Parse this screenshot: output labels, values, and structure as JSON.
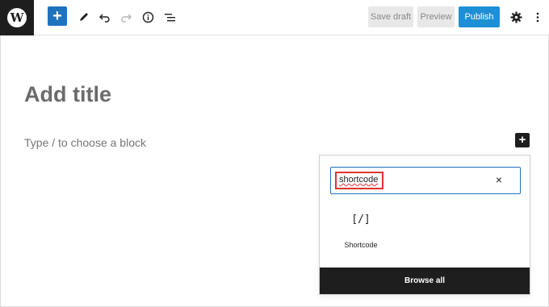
{
  "toolbar": {
    "logo_letter": "W",
    "add_icon": "+",
    "edit_icon": "pencil-icon",
    "undo_icon": "undo-icon",
    "redo_icon": "redo-icon",
    "info_icon": "info-icon",
    "list_view_icon": "list-view-icon",
    "save_draft_label": "Save draft",
    "preview_label": "Preview",
    "publish_label": "Publish",
    "settings_icon": "gear-icon",
    "more_icon": "vertical-ellipsis-icon"
  },
  "editor": {
    "title_placeholder": "Add title",
    "block_placeholder": "Type / to choose a block",
    "inserter_toggle": "+"
  },
  "inserter": {
    "search_value": "shortcode",
    "clear_icon": "×",
    "results": [
      {
        "icon": "[/]",
        "label": "Shortcode"
      }
    ],
    "browse_all_label": "Browse all"
  },
  "colors": {
    "primary_blue": "#1e73be",
    "publish_blue": "#1e8fd6",
    "dark": "#1e1e1e",
    "highlight_red": "#e2342c"
  }
}
